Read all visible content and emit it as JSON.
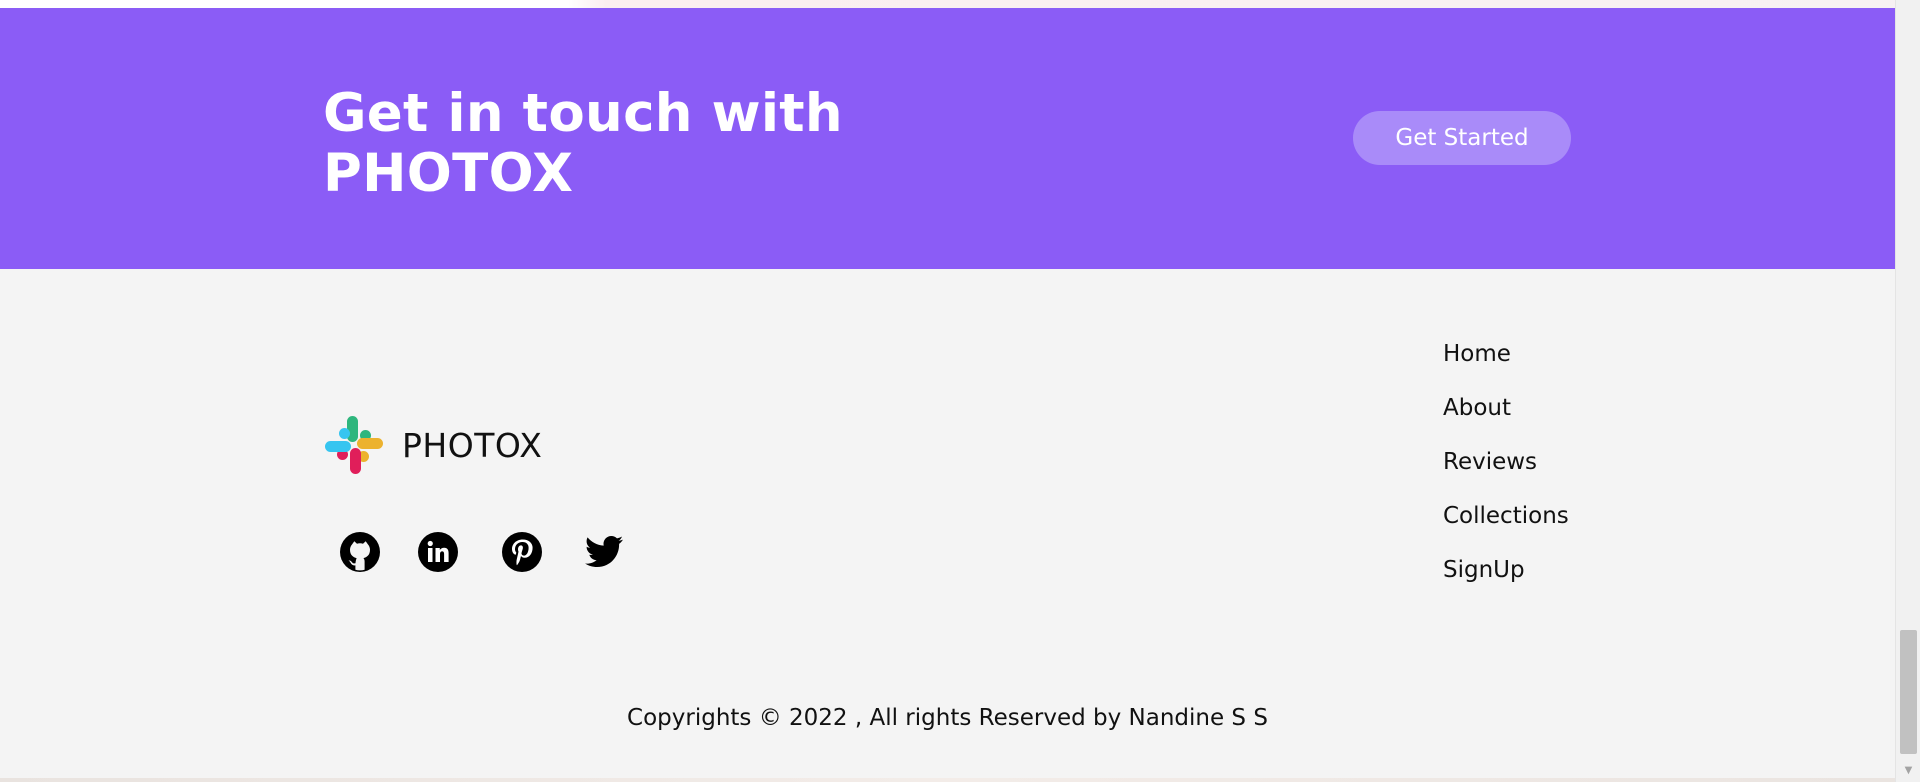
{
  "cta": {
    "title": "Get in touch with PHOTOX",
    "button_label": "Get Started"
  },
  "brand": {
    "name": "PHOTOX",
    "logo_icon": "slack-style-logo-icon",
    "logo_colors": [
      "#36c5f0",
      "#2eb67d",
      "#ecb22e",
      "#e01e5a"
    ]
  },
  "social": [
    {
      "name": "github",
      "icon": "github-icon"
    },
    {
      "name": "linkedin",
      "icon": "linkedin-icon"
    },
    {
      "name": "pinterest",
      "icon": "pinterest-icon"
    },
    {
      "name": "twitter",
      "icon": "twitter-icon"
    }
  ],
  "nav": {
    "items": [
      {
        "label": "Home"
      },
      {
        "label": "About"
      },
      {
        "label": "Reviews"
      },
      {
        "label": "Collections"
      },
      {
        "label": "SignUp"
      }
    ]
  },
  "footer": {
    "copyright": "Copyrights © 2022 , All rights Reserved by Nandine S S"
  },
  "colors": {
    "accent": "#8b5cf6",
    "button": "#a98bf9",
    "footer_bg": "#f4f4f4",
    "text": "#111111"
  }
}
